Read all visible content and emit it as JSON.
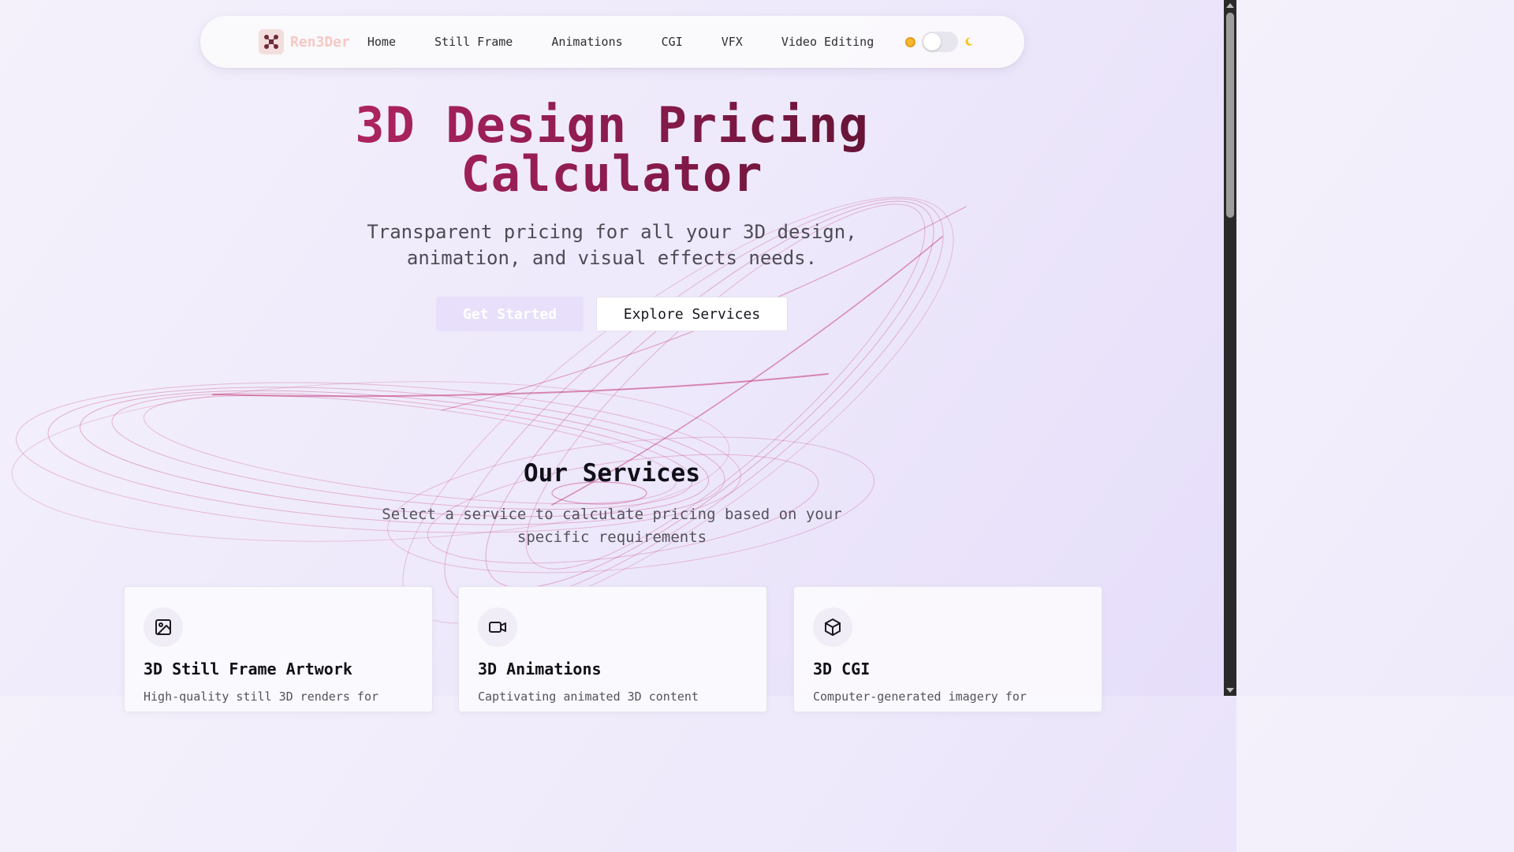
{
  "navbar": {
    "brand": "Ren3Der",
    "links": [
      "Home",
      "Still Frame",
      "Animations",
      "CGI",
      "VFX",
      "Video Editing"
    ],
    "theme_toggle": {
      "state": "light"
    }
  },
  "hero": {
    "title_line1": "3D Design Pricing",
    "title_line2": "Calculator",
    "subtitle": "Transparent pricing for all your 3D design, animation, and visual effects needs.",
    "primary_button": "Get Started",
    "secondary_button": "Explore Services"
  },
  "services": {
    "title": "Our Services",
    "subtitle": "Select a service to calculate pricing based on your specific requirements",
    "cards": [
      {
        "icon": "image-icon",
        "title": "3D Still Frame Artwork",
        "desc": "High-quality still 3D renders for"
      },
      {
        "icon": "video-camera-icon",
        "title": "3D Animations",
        "desc": "Captivating animated 3D content"
      },
      {
        "icon": "cube-icon",
        "title": "3D CGI",
        "desc": "Computer-generated imagery for"
      }
    ]
  },
  "colors": {
    "accent": "#8f1f55",
    "brand_text": "#f6c9c4",
    "primary_button_bg": "#e8e0fb",
    "swirl": "#c2347a"
  }
}
